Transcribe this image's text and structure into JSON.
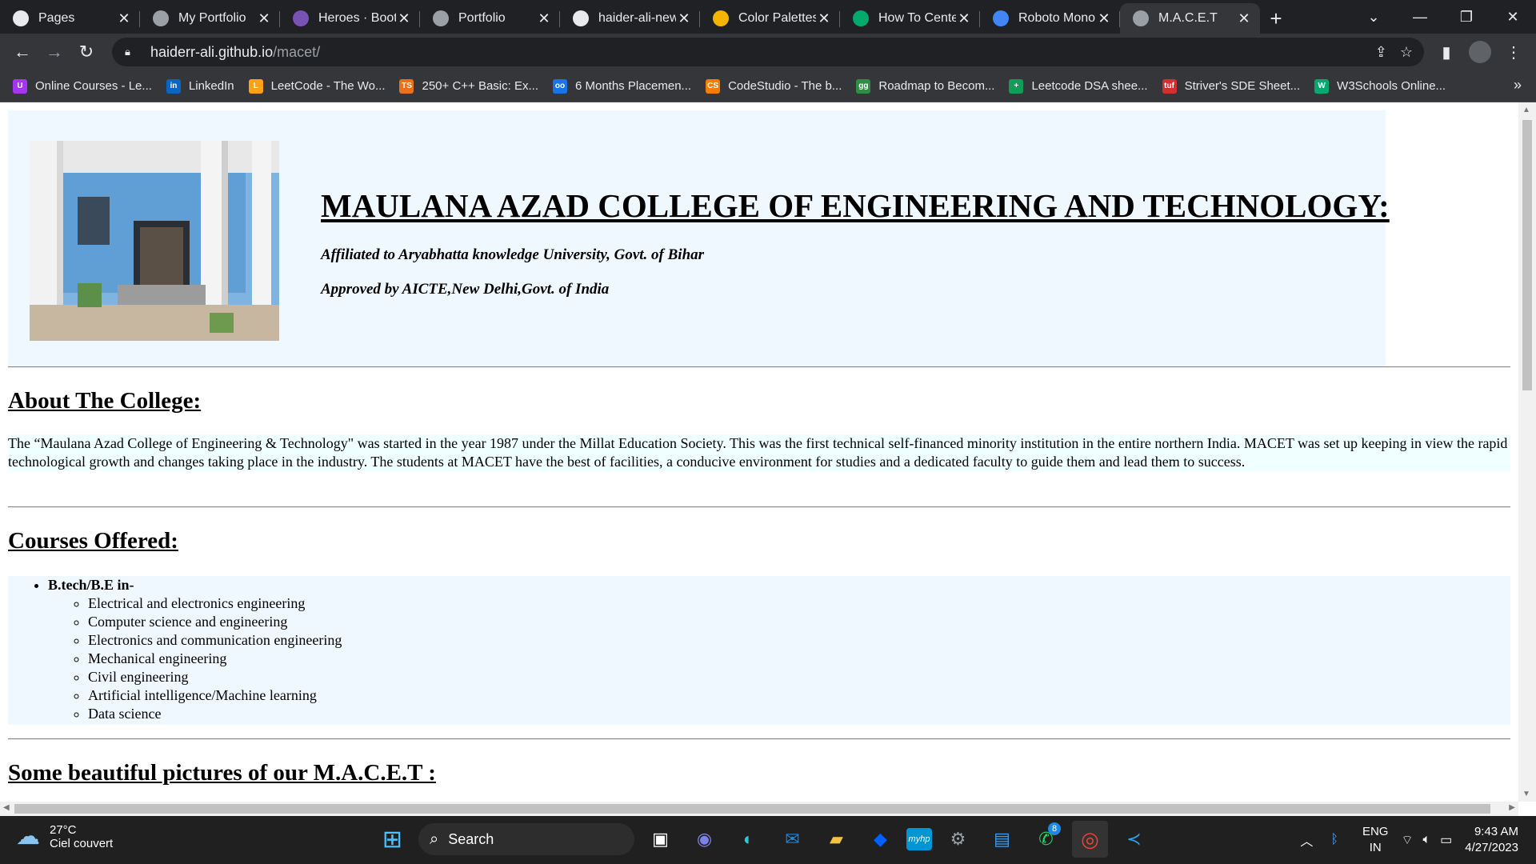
{
  "browser": {
    "tabs": [
      {
        "label": "Pages",
        "icon": "github-icon",
        "color": "#e8eaed"
      },
      {
        "label": "My Portfolio",
        "icon": "globe-icon",
        "color": "#9aa0a6"
      },
      {
        "label": "Heroes · Bootstr",
        "icon": "bootstrap-icon",
        "color": "#7952b3"
      },
      {
        "label": "Portfolio",
        "icon": "globe-icon",
        "color": "#9aa0a6"
      },
      {
        "label": "haider-ali-new-",
        "icon": "github-icon",
        "color": "#e8eaed"
      },
      {
        "label": "Color Palettes",
        "icon": "palette-icon",
        "color": "#f4b400"
      },
      {
        "label": "How To Center",
        "icon": "w3schools-icon",
        "color": "#04aa6d"
      },
      {
        "label": "Roboto Mono",
        "icon": "google-fonts-icon",
        "color": "#4285f4"
      },
      {
        "label": "M.A.C.E.T",
        "icon": "globe-icon",
        "color": "#9aa0a6",
        "active": true
      }
    ],
    "url_host": "haiderr-ali.github.io",
    "url_path": "/macet/",
    "bookmarks": [
      {
        "label": "Online Courses - Le...",
        "color": "#a435f0",
        "text": "U"
      },
      {
        "label": "LinkedIn",
        "color": "#0a66c2",
        "text": "in"
      },
      {
        "label": "LeetCode - The Wo...",
        "color": "#ffa116",
        "text": "L"
      },
      {
        "label": "250+ C++ Basic: Ex...",
        "color": "#e8711a",
        "text": "TS"
      },
      {
        "label": "6 Months Placemen...",
        "color": "#1a73e8",
        "text": "oo"
      },
      {
        "label": "CodeStudio - The b...",
        "color": "#f57c00",
        "text": "CS"
      },
      {
        "label": "Roadmap to Becom...",
        "color": "#2f8d46",
        "text": "gg"
      },
      {
        "label": "Leetcode DSA shee...",
        "color": "#0f9d58",
        "text": "+"
      },
      {
        "label": "Striver's SDE Sheet...",
        "color": "#d32f2f",
        "text": "tuf"
      },
      {
        "label": "W3Schools Online...",
        "color": "#04aa6d",
        "text": "W"
      }
    ]
  },
  "page": {
    "title": "MAULANA AZAD COLLEGE OF ENGINEERING AND TECHNOLOGY:",
    "affiliation": "Affiliated to Aryabhatta knowledge University, Govt. of Bihar",
    "approval": "Approved by AICTE,New Delhi,Govt. of India",
    "about_heading": "About The College:",
    "about_text": "The “Maulana Azad College of Engineering & Technology\" was started in the year 1987 under the Millat Education Society. This was the first technical self-financed minority institution in the entire northern India. MACET was set up keeping in view the rapid technological growth and changes taking place in the industry. The students at MACET have the best of facilities, a conducive environment for studies and a dedicated faculty to guide them and lead them to success.",
    "courses_heading": "Courses Offered:",
    "degree": "B.tech/B.E in-",
    "courses": [
      "Electrical and electronics engineering",
      "Computer science and engineering",
      "Electronics and communication engineering",
      "Mechanical engineering",
      "Civil engineering",
      "Artificial intelligence/Machine learning",
      "Data science"
    ],
    "pictures_heading": "Some beautiful pictures of our M.A.C.E.T :"
  },
  "taskbar": {
    "temp": "27°C",
    "weather": "Ciel couvert",
    "search": "Search",
    "lang1": "ENG",
    "lang2": "IN",
    "time": "9:43 AM",
    "date": "4/27/2023",
    "whatsapp_badge": "8"
  }
}
